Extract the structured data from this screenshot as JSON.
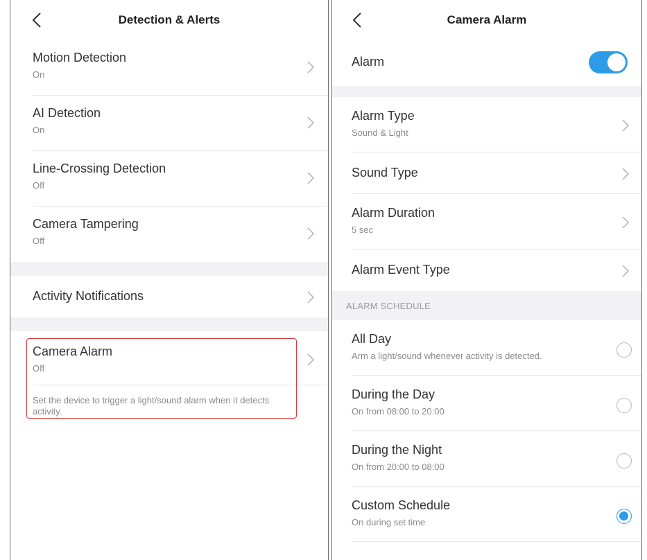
{
  "left": {
    "title": "Detection & Alerts",
    "items": [
      {
        "label": "Motion Detection",
        "value": "On"
      },
      {
        "label": "AI Detection",
        "value": "On"
      },
      {
        "label": "Line-Crossing Detection",
        "value": "Off"
      },
      {
        "label": "Camera Tampering",
        "value": "Off"
      }
    ],
    "activity": {
      "label": "Activity Notifications"
    },
    "camera_alarm": {
      "label": "Camera Alarm",
      "value": "Off",
      "description": "Set the device to trigger a light/sound alarm when it detects activity."
    }
  },
  "right": {
    "title": "Camera Alarm",
    "alarm": {
      "label": "Alarm",
      "enabled": true
    },
    "settings": [
      {
        "label": "Alarm Type",
        "value": "Sound & Light"
      },
      {
        "label": "Sound Type"
      },
      {
        "label": "Alarm Duration",
        "value": "5 sec"
      },
      {
        "label": "Alarm Event Type"
      }
    ],
    "schedule_header": "ALARM SCHEDULE",
    "schedule": [
      {
        "label": "All Day",
        "value": "Arm a light/sound whenever activity is detected.",
        "selected": false
      },
      {
        "label": "During the Day",
        "value": "On from 08:00 to 20:00",
        "selected": false
      },
      {
        "label": "During the Night",
        "value": "On from 20:00 to 08:00",
        "selected": false
      },
      {
        "label": "Custom Schedule",
        "value": "On during set time",
        "selected": true
      }
    ]
  },
  "colors": {
    "accent": "#2d9ce8",
    "highlight": "#d9363e"
  },
  "icons": {
    "back": "chevron-left-icon",
    "forward": "chevron-right-icon"
  }
}
